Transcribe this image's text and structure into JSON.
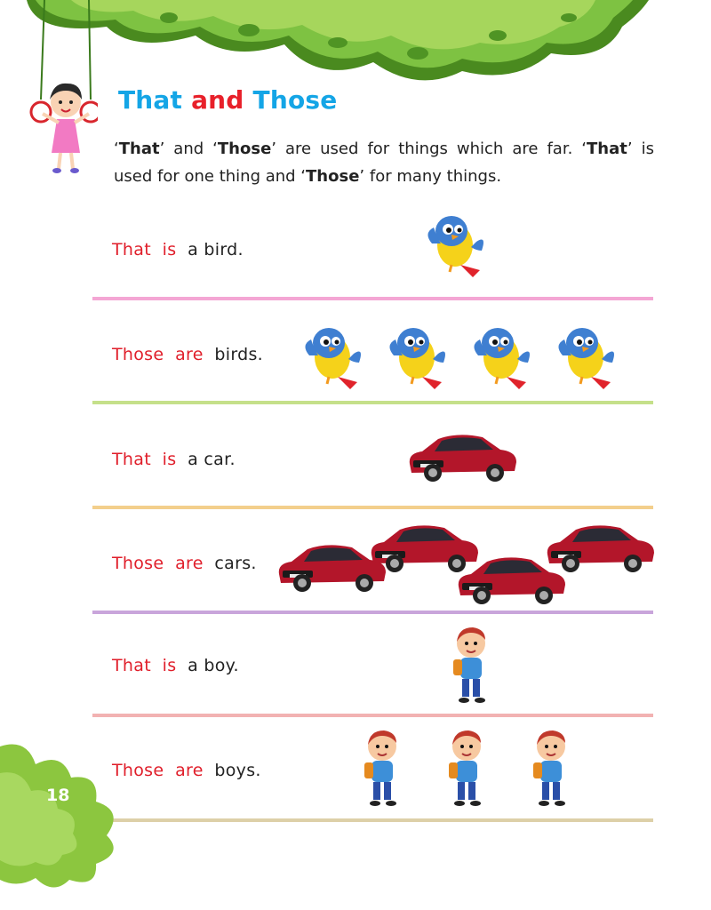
{
  "heading": {
    "word1": "That",
    "word2": "and",
    "word3": "Those"
  },
  "intro": {
    "q1": "‘",
    "w1": "That",
    "t1": "’ and ‘",
    "w2": "Those",
    "t2": "’ are used for things which are far. ‘",
    "w3": "That",
    "t3": "’ is used for one thing and ‘",
    "w4": "Those",
    "t4": "’ for many things."
  },
  "rows": [
    {
      "kw1": "That",
      "kw2": "is",
      "rest": "a bird.",
      "picture": "bird",
      "count": 1
    },
    {
      "kw1": "Those",
      "kw2": "are",
      "rest": "birds.",
      "picture": "bird",
      "count": 4
    },
    {
      "kw1": "That",
      "kw2": "is",
      "rest": "a car.",
      "picture": "car",
      "count": 1
    },
    {
      "kw1": "Those",
      "kw2": "are",
      "rest": "cars.",
      "picture": "car",
      "count": 4
    },
    {
      "kw1": "That",
      "kw2": "is",
      "rest": "a boy.",
      "picture": "boy",
      "count": 1
    },
    {
      "kw1": "Those",
      "kw2": "are",
      "rest": "boys.",
      "picture": "boy",
      "count": 3
    }
  ],
  "divider_colors": [
    "#f4a6d4",
    "#c5e08a",
    "#f3cf8c",
    "#c9a5db",
    "#f2b2b2",
    "#ddd0a8"
  ],
  "colors": {
    "title_blue": "#14a5e6",
    "title_red": "#e8202a",
    "keyword_red": "#e01e2a",
    "leaf_green": "#8cc63f"
  },
  "page_number": "18"
}
